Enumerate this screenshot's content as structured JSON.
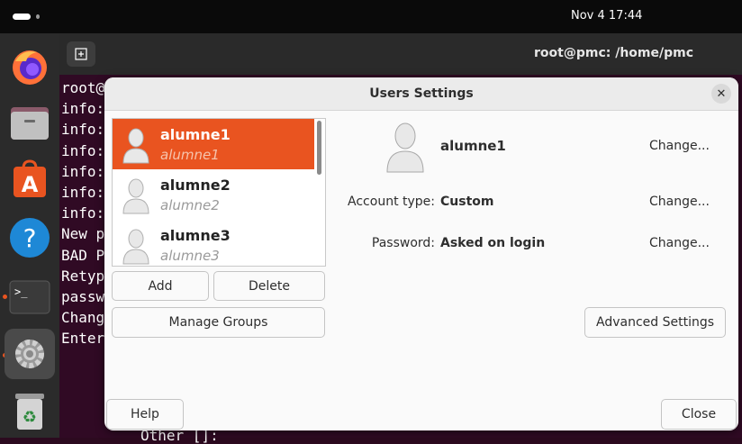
{
  "topbar": {
    "clock": "Nov 4  17:44"
  },
  "dock": {
    "items": [
      "firefox-icon",
      "files-icon",
      "app-center-icon",
      "help-icon",
      "terminal-icon",
      "settings-icon",
      "trash-icon"
    ]
  },
  "terminal": {
    "title": "root@pmc: /home/pmc",
    "lines": [
      "root@",
      "info:",
      "info:",
      "info:",
      "info:",
      "info:",
      "info:",
      "New p",
      "BAD P",
      "Retyp",
      "passw",
      "Chang",
      "Enter"
    ],
    "bottom_line": "Other []:"
  },
  "dialog": {
    "title": "Users Settings",
    "close_glyph": "✕",
    "users": [
      {
        "name": "alumne1",
        "login": "alumne1",
        "selected": true
      },
      {
        "name": "alumne2",
        "login": "alumne2",
        "selected": false
      },
      {
        "name": "alumne3",
        "login": "alumne3",
        "selected": false
      }
    ],
    "add_label": "Add",
    "delete_label": "Delete",
    "manage_groups_label": "Manage Groups",
    "selected_user": "alumne1",
    "change_label": "Change...",
    "account_type_label": "Account type:",
    "account_type_value": "Custom",
    "password_label": "Password:",
    "password_value": "Asked on login",
    "advanced_settings_label": "Advanced Settings",
    "help_label": "Help",
    "close_label": "Close"
  },
  "colors": {
    "accent": "#e95420",
    "terminal_bg": "#300a24"
  }
}
